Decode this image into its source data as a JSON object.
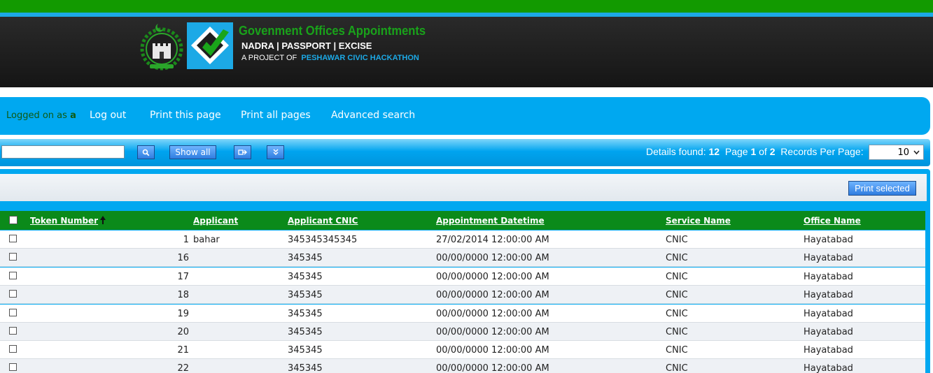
{
  "header": {
    "title": "Govenment Offices Appointments",
    "subtitle": "NADRA | PASSPORT | EXCISE",
    "project_prefix": "A PROJECT OF",
    "project_name": "PESHAWAR CIVIC HACKATHON"
  },
  "nav": {
    "logged_on_as": "Logged on as",
    "user": "a",
    "logout": "Log out",
    "print_page": "Print this page",
    "print_all": "Print all pages",
    "advanced_search": "Advanced search"
  },
  "toolbar": {
    "search_value": "",
    "show_all": "Show all",
    "details_found_label": "Details found:",
    "details_found": "12",
    "page_label": "Page",
    "page": "1",
    "of_label": "of",
    "pages": "2",
    "records_per_page_label": "Records Per Page:",
    "records_per_page": "10"
  },
  "panel": {
    "print_selected": "Print selected"
  },
  "table": {
    "columns": [
      "Token Number",
      "Applicant",
      "Applicant CNIC",
      "Appointment Datetime",
      "Service Name",
      "Office Name"
    ],
    "rows": [
      {
        "token": "1",
        "applicant": "bahar",
        "cnic": "345345345345",
        "datetime": "27/02/2014 12:00:00 AM",
        "service": "CNIC",
        "office": "Hayatabad"
      },
      {
        "token": "16",
        "applicant": "",
        "cnic": "345345",
        "datetime": "00/00/0000 12:00:00 AM",
        "service": "CNIC",
        "office": "Hayatabad"
      },
      {
        "token": "17",
        "applicant": "",
        "cnic": "345345",
        "datetime": "00/00/0000 12:00:00 AM",
        "service": "CNIC",
        "office": "Hayatabad"
      },
      {
        "token": "18",
        "applicant": "",
        "cnic": "345345",
        "datetime": "00/00/0000 12:00:00 AM",
        "service": "CNIC",
        "office": "Hayatabad"
      },
      {
        "token": "19",
        "applicant": "",
        "cnic": "345345",
        "datetime": "00/00/0000 12:00:00 AM",
        "service": "CNIC",
        "office": "Hayatabad"
      },
      {
        "token": "20",
        "applicant": "",
        "cnic": "345345",
        "datetime": "00/00/0000 12:00:00 AM",
        "service": "CNIC",
        "office": "Hayatabad"
      },
      {
        "token": "21",
        "applicant": "",
        "cnic": "345345",
        "datetime": "00/00/0000 12:00:00 AM",
        "service": "CNIC",
        "office": "Hayatabad"
      },
      {
        "token": "22",
        "applicant": "",
        "cnic": "345345",
        "datetime": "00/00/0000 12:00:00 AM",
        "service": "CNIC",
        "office": "Hayatabad"
      }
    ]
  },
  "colors": {
    "green": "#129a00",
    "blue": "#00a8f0",
    "header_bg": "#1e1e1e",
    "grid_header": "#0b8a1a"
  },
  "icons": [
    "emblem-icon",
    "logo-icon",
    "search-icon",
    "export-icon",
    "expand-down-icon",
    "sort-asc-icon",
    "checkbox-icon"
  ]
}
